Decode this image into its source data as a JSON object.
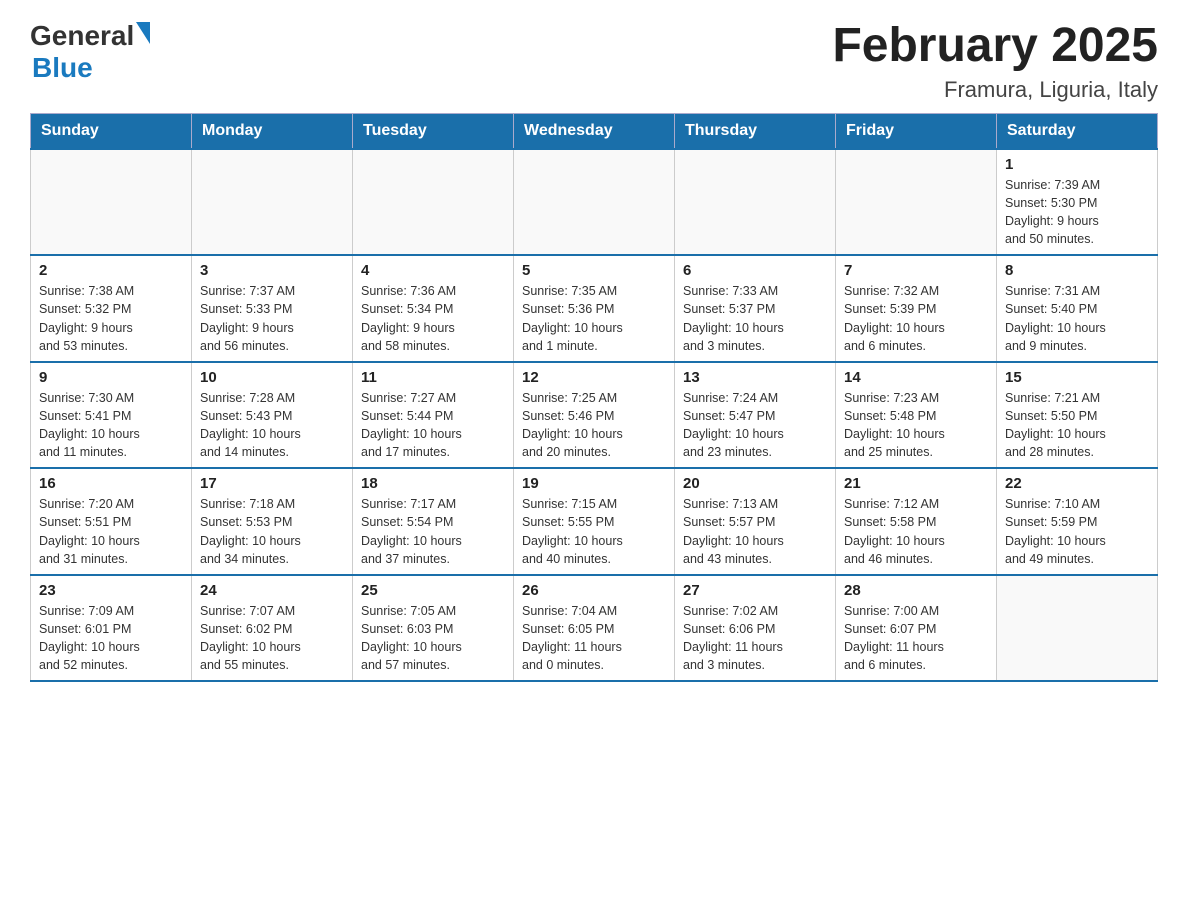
{
  "header": {
    "logo_general": "General",
    "logo_blue": "Blue",
    "month_title": "February 2025",
    "location": "Framura, Liguria, Italy"
  },
  "weekdays": [
    "Sunday",
    "Monday",
    "Tuesday",
    "Wednesday",
    "Thursday",
    "Friday",
    "Saturday"
  ],
  "weeks": [
    [
      {
        "day": "",
        "info": ""
      },
      {
        "day": "",
        "info": ""
      },
      {
        "day": "",
        "info": ""
      },
      {
        "day": "",
        "info": ""
      },
      {
        "day": "",
        "info": ""
      },
      {
        "day": "",
        "info": ""
      },
      {
        "day": "1",
        "info": "Sunrise: 7:39 AM\nSunset: 5:30 PM\nDaylight: 9 hours\nand 50 minutes."
      }
    ],
    [
      {
        "day": "2",
        "info": "Sunrise: 7:38 AM\nSunset: 5:32 PM\nDaylight: 9 hours\nand 53 minutes."
      },
      {
        "day": "3",
        "info": "Sunrise: 7:37 AM\nSunset: 5:33 PM\nDaylight: 9 hours\nand 56 minutes."
      },
      {
        "day": "4",
        "info": "Sunrise: 7:36 AM\nSunset: 5:34 PM\nDaylight: 9 hours\nand 58 minutes."
      },
      {
        "day": "5",
        "info": "Sunrise: 7:35 AM\nSunset: 5:36 PM\nDaylight: 10 hours\nand 1 minute."
      },
      {
        "day": "6",
        "info": "Sunrise: 7:33 AM\nSunset: 5:37 PM\nDaylight: 10 hours\nand 3 minutes."
      },
      {
        "day": "7",
        "info": "Sunrise: 7:32 AM\nSunset: 5:39 PM\nDaylight: 10 hours\nand 6 minutes."
      },
      {
        "day": "8",
        "info": "Sunrise: 7:31 AM\nSunset: 5:40 PM\nDaylight: 10 hours\nand 9 minutes."
      }
    ],
    [
      {
        "day": "9",
        "info": "Sunrise: 7:30 AM\nSunset: 5:41 PM\nDaylight: 10 hours\nand 11 minutes."
      },
      {
        "day": "10",
        "info": "Sunrise: 7:28 AM\nSunset: 5:43 PM\nDaylight: 10 hours\nand 14 minutes."
      },
      {
        "day": "11",
        "info": "Sunrise: 7:27 AM\nSunset: 5:44 PM\nDaylight: 10 hours\nand 17 minutes."
      },
      {
        "day": "12",
        "info": "Sunrise: 7:25 AM\nSunset: 5:46 PM\nDaylight: 10 hours\nand 20 minutes."
      },
      {
        "day": "13",
        "info": "Sunrise: 7:24 AM\nSunset: 5:47 PM\nDaylight: 10 hours\nand 23 minutes."
      },
      {
        "day": "14",
        "info": "Sunrise: 7:23 AM\nSunset: 5:48 PM\nDaylight: 10 hours\nand 25 minutes."
      },
      {
        "day": "15",
        "info": "Sunrise: 7:21 AM\nSunset: 5:50 PM\nDaylight: 10 hours\nand 28 minutes."
      }
    ],
    [
      {
        "day": "16",
        "info": "Sunrise: 7:20 AM\nSunset: 5:51 PM\nDaylight: 10 hours\nand 31 minutes."
      },
      {
        "day": "17",
        "info": "Sunrise: 7:18 AM\nSunset: 5:53 PM\nDaylight: 10 hours\nand 34 minutes."
      },
      {
        "day": "18",
        "info": "Sunrise: 7:17 AM\nSunset: 5:54 PM\nDaylight: 10 hours\nand 37 minutes."
      },
      {
        "day": "19",
        "info": "Sunrise: 7:15 AM\nSunset: 5:55 PM\nDaylight: 10 hours\nand 40 minutes."
      },
      {
        "day": "20",
        "info": "Sunrise: 7:13 AM\nSunset: 5:57 PM\nDaylight: 10 hours\nand 43 minutes."
      },
      {
        "day": "21",
        "info": "Sunrise: 7:12 AM\nSunset: 5:58 PM\nDaylight: 10 hours\nand 46 minutes."
      },
      {
        "day": "22",
        "info": "Sunrise: 7:10 AM\nSunset: 5:59 PM\nDaylight: 10 hours\nand 49 minutes."
      }
    ],
    [
      {
        "day": "23",
        "info": "Sunrise: 7:09 AM\nSunset: 6:01 PM\nDaylight: 10 hours\nand 52 minutes."
      },
      {
        "day": "24",
        "info": "Sunrise: 7:07 AM\nSunset: 6:02 PM\nDaylight: 10 hours\nand 55 minutes."
      },
      {
        "day": "25",
        "info": "Sunrise: 7:05 AM\nSunset: 6:03 PM\nDaylight: 10 hours\nand 57 minutes."
      },
      {
        "day": "26",
        "info": "Sunrise: 7:04 AM\nSunset: 6:05 PM\nDaylight: 11 hours\nand 0 minutes."
      },
      {
        "day": "27",
        "info": "Sunrise: 7:02 AM\nSunset: 6:06 PM\nDaylight: 11 hours\nand 3 minutes."
      },
      {
        "day": "28",
        "info": "Sunrise: 7:00 AM\nSunset: 6:07 PM\nDaylight: 11 hours\nand 6 minutes."
      },
      {
        "day": "",
        "info": ""
      }
    ]
  ]
}
